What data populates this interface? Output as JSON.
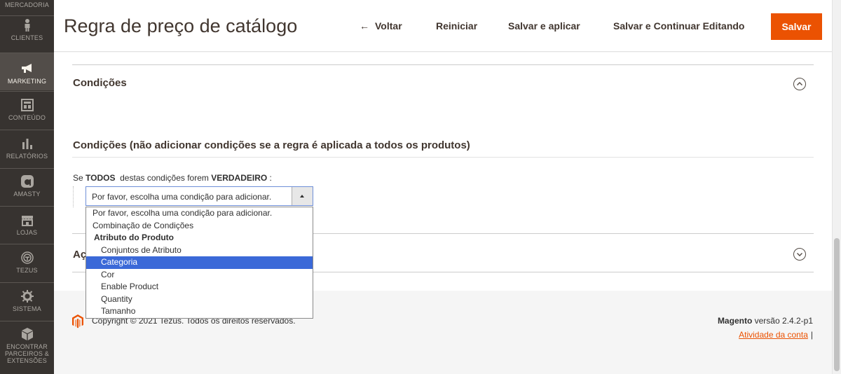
{
  "sidebar": {
    "items": [
      {
        "label": "MERCADORIA",
        "icon": "cart-icon"
      },
      {
        "label": "CLIENTES",
        "icon": "person-icon"
      },
      {
        "label": "MARKETING",
        "icon": "megaphone-icon"
      },
      {
        "label": "CONTEÚDO",
        "icon": "layout-icon"
      },
      {
        "label": "RELATÓRIOS",
        "icon": "bar-chart-icon"
      },
      {
        "label": "AMASTY",
        "icon": "amasty-icon"
      },
      {
        "label": "LOJAS",
        "icon": "store-icon"
      },
      {
        "label": "TEZUS",
        "icon": "tezus-icon"
      },
      {
        "label": "SISTEMA",
        "icon": "gear-icon"
      },
      {
        "label": "ENCONTRAR PARCEIROS & EXTENSÕES",
        "icon": "box-icon"
      }
    ]
  },
  "header": {
    "title": "Regra de preço de catálogo",
    "back_label": "Voltar",
    "reset_label": "Reiniciar",
    "save_apply_label": "Salvar e aplicar",
    "save_continue_label": "Salvar e Continuar Editando",
    "save_label": "Salvar"
  },
  "conditions": {
    "section_title": "Condições",
    "fieldset_title": "Condições (não adicionar condições se a regra é aplicada a todos os produtos)",
    "rule_prefix": "Se ",
    "rule_all": "TODOS",
    "rule_middle": "  destas condições forem ",
    "rule_true": "VERDADEIRO",
    "rule_suffix": " :",
    "select_value": "Por favor, escolha uma condição para adicionar."
  },
  "dropdown": {
    "options": [
      {
        "label": "Por favor, escolha uma condição para adicionar.",
        "kind": "option"
      },
      {
        "label": "Combinação de Condições",
        "kind": "option"
      },
      {
        "label": "Atributo do Produto",
        "kind": "group"
      },
      {
        "label": "Conjuntos de Atributo",
        "kind": "child"
      },
      {
        "label": "Categoria",
        "kind": "child",
        "selected": true
      },
      {
        "label": "Cor",
        "kind": "child"
      },
      {
        "label": "Enable Product",
        "kind": "child"
      },
      {
        "label": "Quantity",
        "kind": "child"
      },
      {
        "label": "Tamanho",
        "kind": "child"
      }
    ]
  },
  "actions_section": {
    "title_visible": "Aç"
  },
  "footer": {
    "copyright": "Copyright © 2021 Tezus. Todos os direitos reservados.",
    "brand": "Magento",
    "version": " versão 2.4.2-p1",
    "account_link": "Atividade da conta",
    "pipe": "|"
  },
  "colors": {
    "accent": "#eb5202",
    "sidebar_bg": "#373330",
    "selected_option": "#3b69d8"
  }
}
